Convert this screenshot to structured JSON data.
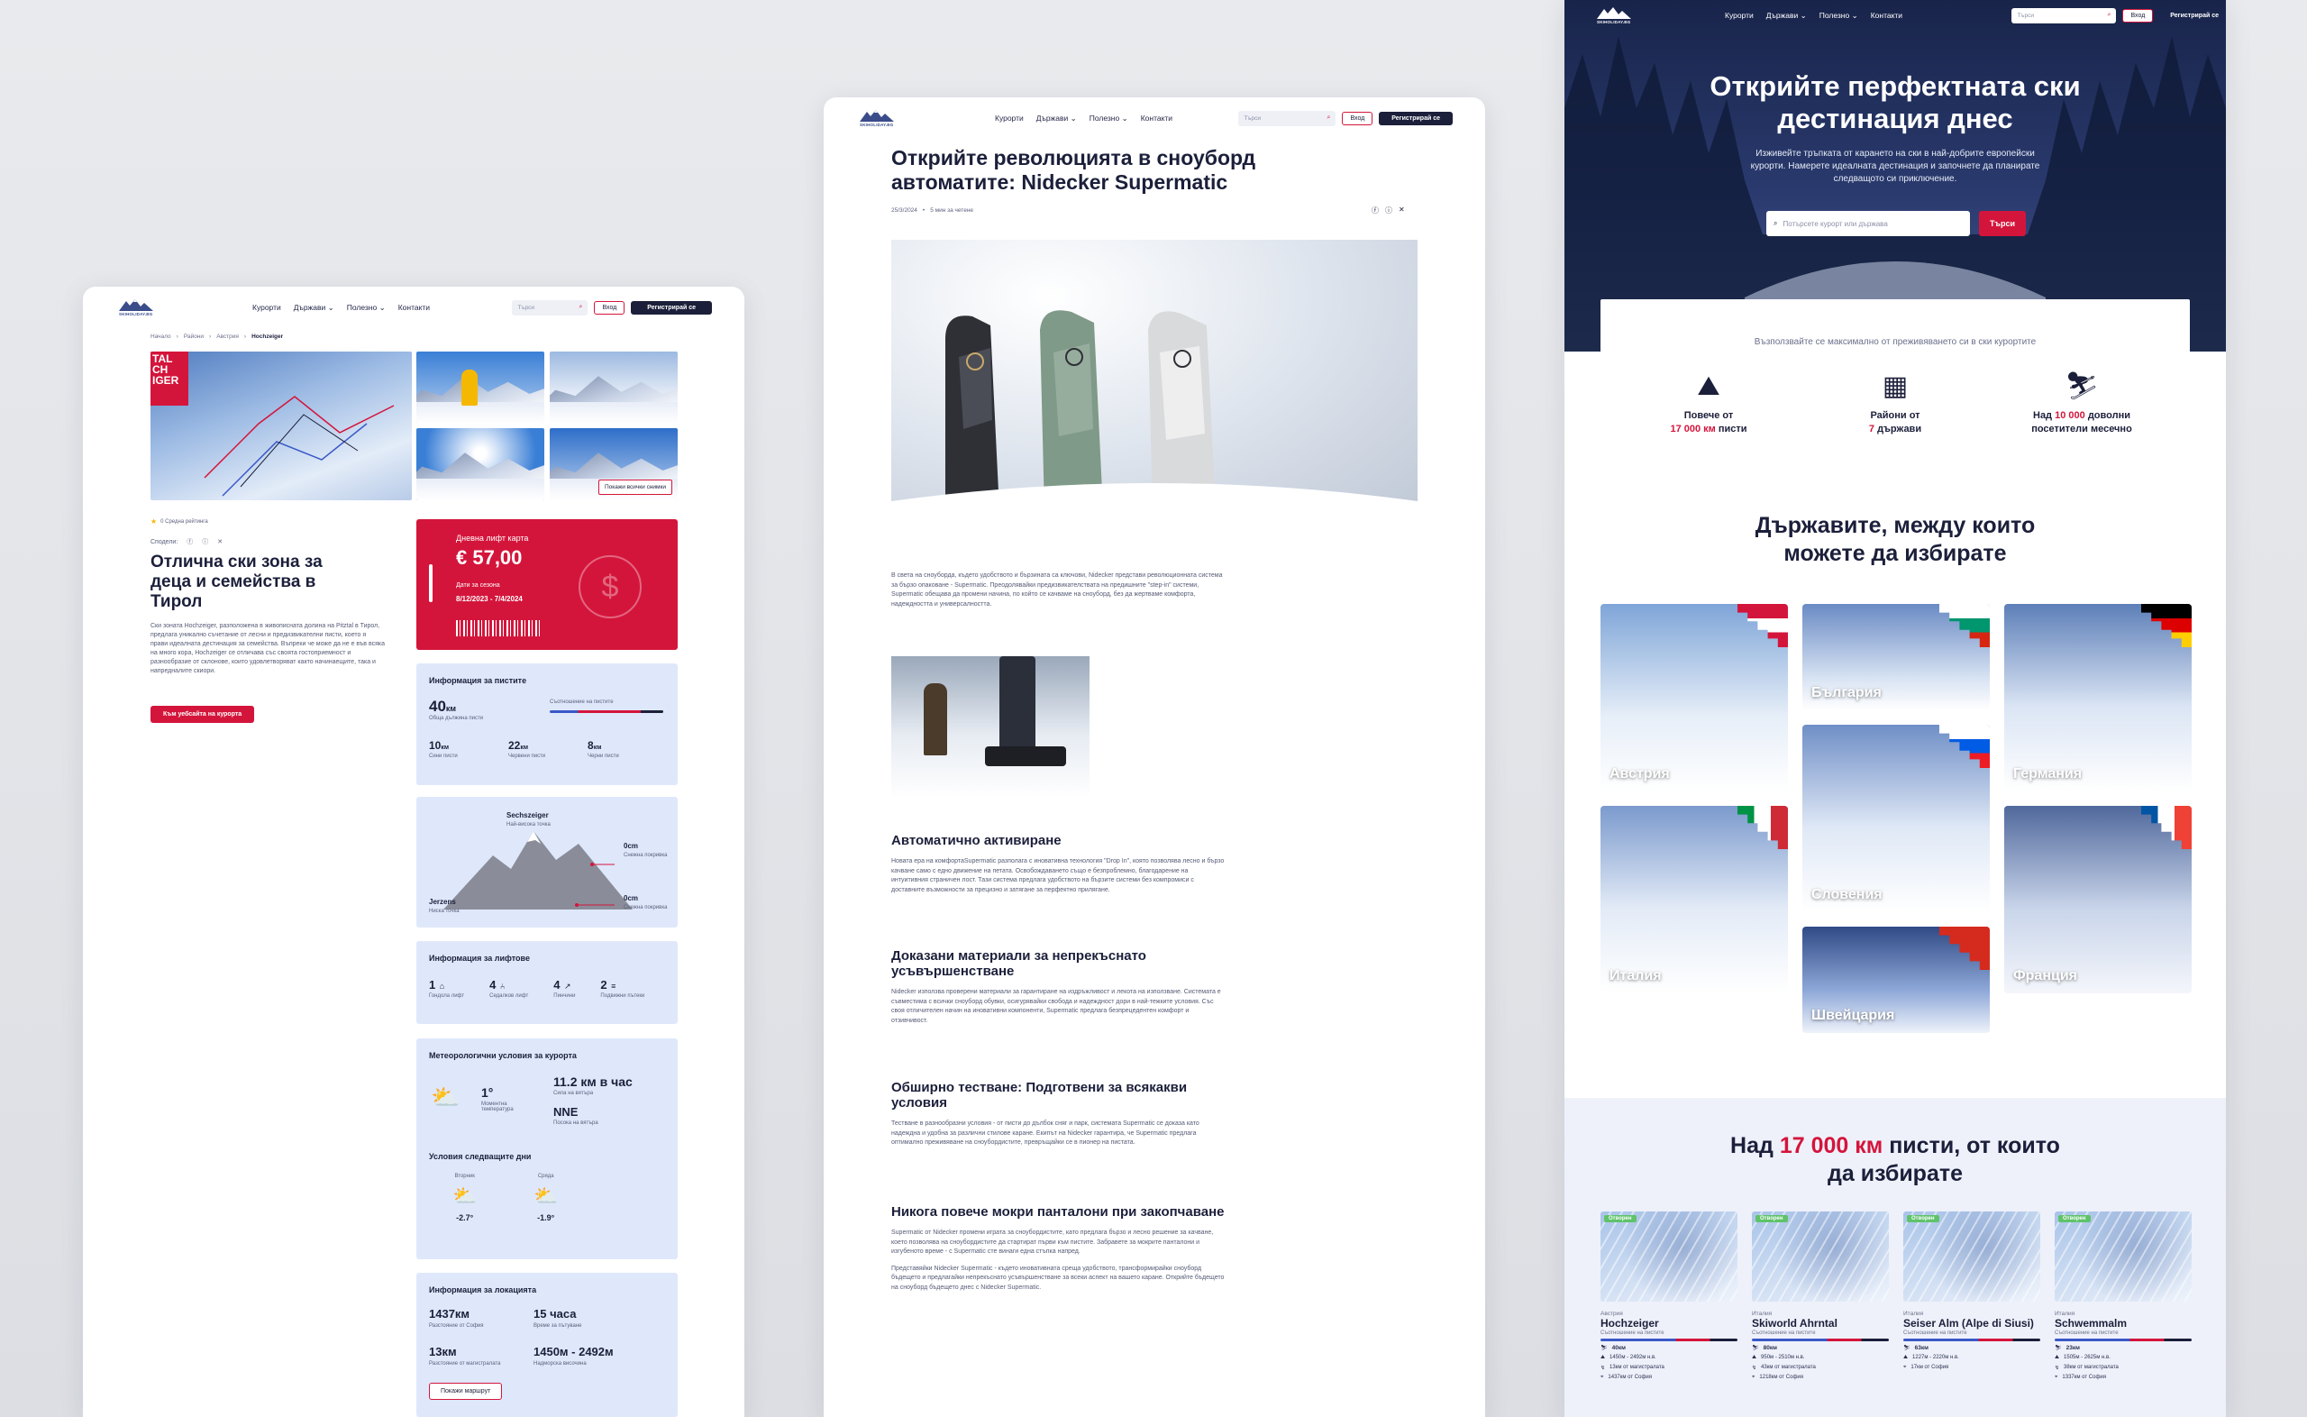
{
  "nav": {
    "logo_text": "SKIHOLIDAY.BG",
    "links": [
      "Курорти",
      "Държави",
      "Полезно",
      "Контакти"
    ],
    "search_placeholder": "Търси",
    "login": "Вход",
    "register": "Регистрирай се"
  },
  "left": {
    "breadcrumbs": [
      "Начало",
      "Райони",
      "Австрия",
      "Hochzeiger"
    ],
    "map_overlay": "TAL\nCH\nIGER",
    "show_all_photos": "Покажи всички снимки",
    "rating_text": "0 Средна рейтинга",
    "share_label": "Сподели:",
    "title": "Отлична ски зона за деца и семейства в Тирол",
    "description": "Ски зоната Hochzeiger, разположена в живописната долина на Pitztal в Тирол, предлага уникално съчетание от лесни и предизвикателни писти, което я прави идеалната дестинация за семейства. Въпреки че може да не е във всяка на много кора, Hochzeiger се отличава със своята гостоприемност и разнообразие от склонове, които удовлетворяват както начинаещите, така и напредналите скиори.",
    "site_button": "Към уебсайта на курорта",
    "lift_card": {
      "label": "Дневна лифт карта",
      "price": "€ 57,00",
      "dates_label": "Дати за сезона",
      "dates": "8/12/2023 - 7/4/2024"
    },
    "slopes": {
      "title": "Информация за пистите",
      "total": "40",
      "total_unit": "км",
      "total_label": "Обща дължина писти",
      "ratio_label": "Съотношение на пистите",
      "blue": "10",
      "blue_label": "Сини писти",
      "red": "22",
      "red_label": "Червени писти",
      "black": "8",
      "black_label": "Черни писти",
      "unit": "км"
    },
    "altitude": {
      "top_name": "Sechszeiger",
      "top_sub": "Най-висока точка",
      "bottom_name": "Jerzens",
      "bottom_sub": "Ниска точка",
      "snow1": "0cm",
      "snow1_label": "Снежна покривка",
      "snow2": "0cm",
      "snow2_label": "Снежна покривка"
    },
    "lifts": {
      "title": "Информация за лифтове",
      "items": [
        {
          "n": "1",
          "label": "Гондола лифт"
        },
        {
          "n": "4",
          "label": "Седалков лифт"
        },
        {
          "n": "4",
          "label": "Пинчини"
        },
        {
          "n": "2",
          "label": "Подвижни пътеки"
        }
      ]
    },
    "weather": {
      "title": "Метеорологични условия за курорта",
      "temp": "1°",
      "temp_label": "Моментна температура",
      "wind": "11.2 км в час",
      "wind_label": "Сила на вятъра",
      "dir": "NNE",
      "dir_label": "Посока на вятъра",
      "next_title": "Условия следващите дни",
      "days": [
        {
          "d": "Вторник",
          "t": "-2.7°"
        },
        {
          "d": "Сряда",
          "t": "-1.9°"
        }
      ]
    },
    "location": {
      "title": "Информация за локацията",
      "items": [
        {
          "v": "1437км",
          "l": "Разстояние от София"
        },
        {
          "v": "15 часа",
          "l": "Време за пътуване"
        },
        {
          "v": "13км",
          "l": "Разстояние от магистралата"
        },
        {
          "v": "1450м - 2492м",
          "l": "Надморска височина"
        }
      ],
      "route_button": "Покажи маршрут"
    }
  },
  "mid": {
    "title": "Открийте революцията в сноуборд автоматите: Nidecker Supermatic",
    "date": "25/3/2024",
    "read": "5 мин за четене",
    "intro": "В света на сноуборда, където удобството и бързината са ключови, Nidecker представи революционната система за бързо опаковане - Supermatic. Преодолявайки предизвикателствата на предишните \"step-in\" системи, Supermatic обещава да промени начина, по който се качваме на сноуборд, без да жертваме комфорта, надеждността и универсалността.",
    "sections": [
      {
        "h": "Автоматично активиране",
        "p": "Новата ера на комфортаSupermatic разполага с иновативна технология \"Drop In\", която позволява лесно и бързо качване само с едно движение на петата. Освобождаването също е безпроблемно, благодарение на интуитивния страничен лост. Тази система предлага удобството на бързите системи без компромиси с доставните възможности за прецизно и затягане за перфектно прилягане."
      },
      {
        "h": "Доказани материали за непрекъснато усъвършенстване",
        "p": "Nidecker използва проверени материали за гарантиране на издръжливост и лекота на използване. Системата е съвместима с всички сноуборд обувки, осигурявайки свобода и надеждност дори в най-тежките условия. Със своя отличителен начин на иновативни компоненти, Supermatic предлага безпрецедентен комфорт и отзивчивост."
      },
      {
        "h": "Обширно тестване: Подготвени за всякакви условия",
        "p": "Тестване в разнообразни условия - от писти до дълбок сняг и парк, системата Supermatic се доказа като надеждна и удобна за различни стилове каране. Екипът на Nidecker гарантира, че Supermatic предлага оптимално преживяване на сноубордистите, превръщайки се в пионер на пистата."
      },
      {
        "h": "Никога повече мокри панталони при закопчаване",
        "p": "Supermatic от Nidecker промени играта за сноубордистите, като предлага бързо и лесно решение за качване, което позволява на сноубордистите да стартират първи към пистите. Забравете за мокрите панталони и изгубеното време - с Supermatic сте винаги една стъпка напред."
      }
    ],
    "outro": "Представяйки Nidecker Supermatic - където иновативната среща удобството, трансформирайки сноуборд бъдещето и предлагайки непрекъснато усъвършенстване за всеки аспект на вашето каране. Открийте бъдещето на сноуборд бъдещето днес с Nidecker Supermatic."
  },
  "right": {
    "hero_title": "Открийте перфектната ски дестинация днес",
    "hero_sub": "Изживейте тръпката от карането на ски в най-добрите европейски курорти. Намерете идеалната дестинация и започнете да планирате следващото си приключение.",
    "search_placeholder": "Потърсете курорт или държава",
    "search_button": "Търси",
    "tagline": "Възползвайте се максимално от преживяването си в ски курортите",
    "features": [
      {
        "pre": "Повече от",
        "hl": "17 000 км",
        "post": "писти"
      },
      {
        "pre": "Райони от",
        "hl": "7",
        "post": "държави"
      },
      {
        "pre": "Над",
        "hl": "10 000",
        "post": "доволни посетители месечно"
      }
    ],
    "countries_title": "Държавите, между които можете да избирате",
    "countries": [
      "Австрия",
      "България",
      "Германия",
      "Словения",
      "Италия",
      "Франция",
      "Швейцария"
    ],
    "slopes_title_pre": "Над",
    "slopes_title_hl": "17 000 км",
    "slopes_title_post": "писти, от които да избирате",
    "resorts": [
      {
        "tag": "Отворен",
        "country": "Австрия",
        "name": "Hochzeiger",
        "stat": "Съотношение на пистите",
        "km": "40км",
        "alt": "1450м - 2492м н.в.",
        "hw": "13км от магистралата",
        "sofia": "1437км от София"
      },
      {
        "tag": "Отворен",
        "country": "Италия",
        "name": "Skiworld Ahrntal",
        "stat": "Съотношение на пистите",
        "km": "80км",
        "alt": "950м - 2510м н.в.",
        "hw": "43км от магистралата",
        "sofia": "1218км от София"
      },
      {
        "tag": "Отворен",
        "country": "Италия",
        "name": "Seiser Alm (Alpe di Siusi)",
        "stat": "Съотношение на пистите",
        "km": "63км",
        "alt": "1227м - 2220м н.в.",
        "hw": "17км от София",
        "sofia": ""
      },
      {
        "tag": "Отворен",
        "country": "Италия",
        "name": "Schwemmalm",
        "stat": "Съотношение на пистите",
        "km": "23км",
        "alt": "1505м - 2625м н.в.",
        "hw": "38км от магистралата",
        "sofia": "1337км от София"
      }
    ]
  }
}
